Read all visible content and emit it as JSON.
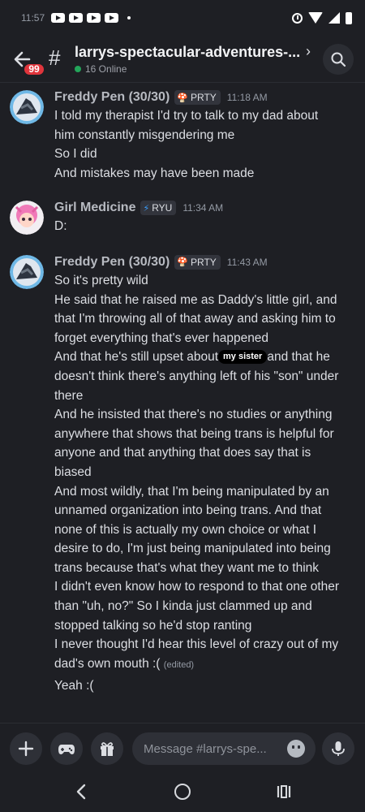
{
  "status_bar": {
    "time": "11:57"
  },
  "header": {
    "unread_badge": "99",
    "channel_name": "larrys-spectacular-adventures-...",
    "online": "16 Online"
  },
  "messages": [
    {
      "author": "Freddy Pen (30/30)",
      "tag": "PRTY",
      "tag_icon": "mushroom-icon",
      "time": "11:18 AM",
      "lines": [
        "I told my therapist I'd try to talk to my dad about",
        "him constantly misgendering me",
        "So I did",
        "And mistakes may have been made"
      ]
    },
    {
      "author": "Girl Medicine",
      "tag": "RYU",
      "tag_icon": "lightning-icon",
      "time": "11:34 AM",
      "lines": [
        "D:"
      ]
    },
    {
      "author": "Freddy Pen (30/30)",
      "tag": "PRTY",
      "tag_icon": "mushroom-icon",
      "time": "11:43 AM",
      "lines": [
        "So it's pretty wild",
        "He said that he raised me as Daddy's little girl, and",
        "that I'm throwing all of that away and asking him to",
        "forget everything that's ever happened",
        "And that he's still upset about",
        "and that he",
        "doesn't think there's anything left of his \"son\" under",
        "there",
        "And he insisted that there's no studies or anything",
        "anywhere that shows that being trans is helpful for",
        "anyone and that anything that does say that is",
        "biased",
        "And most wildly, that I'm being manipulated by an",
        "unnamed organization into being trans. And that",
        "none of this is actually my own choice or what I",
        "desire to do, I'm just being manipulated into being",
        "trans because that's what they want me to think",
        "I didn't even know how to respond to that one other",
        "than \"uh, no?\" So I kinda just clammed up and",
        "stopped talking so he'd stop ranting",
        "I never thought I'd hear this level of crazy out of my",
        "dad's own mouth :(",
        "Yeah :("
      ],
      "redaction_label": "my sister",
      "edited_label": "(edited)"
    }
  ],
  "composer": {
    "placeholder": "Message #larrys-spe..."
  }
}
